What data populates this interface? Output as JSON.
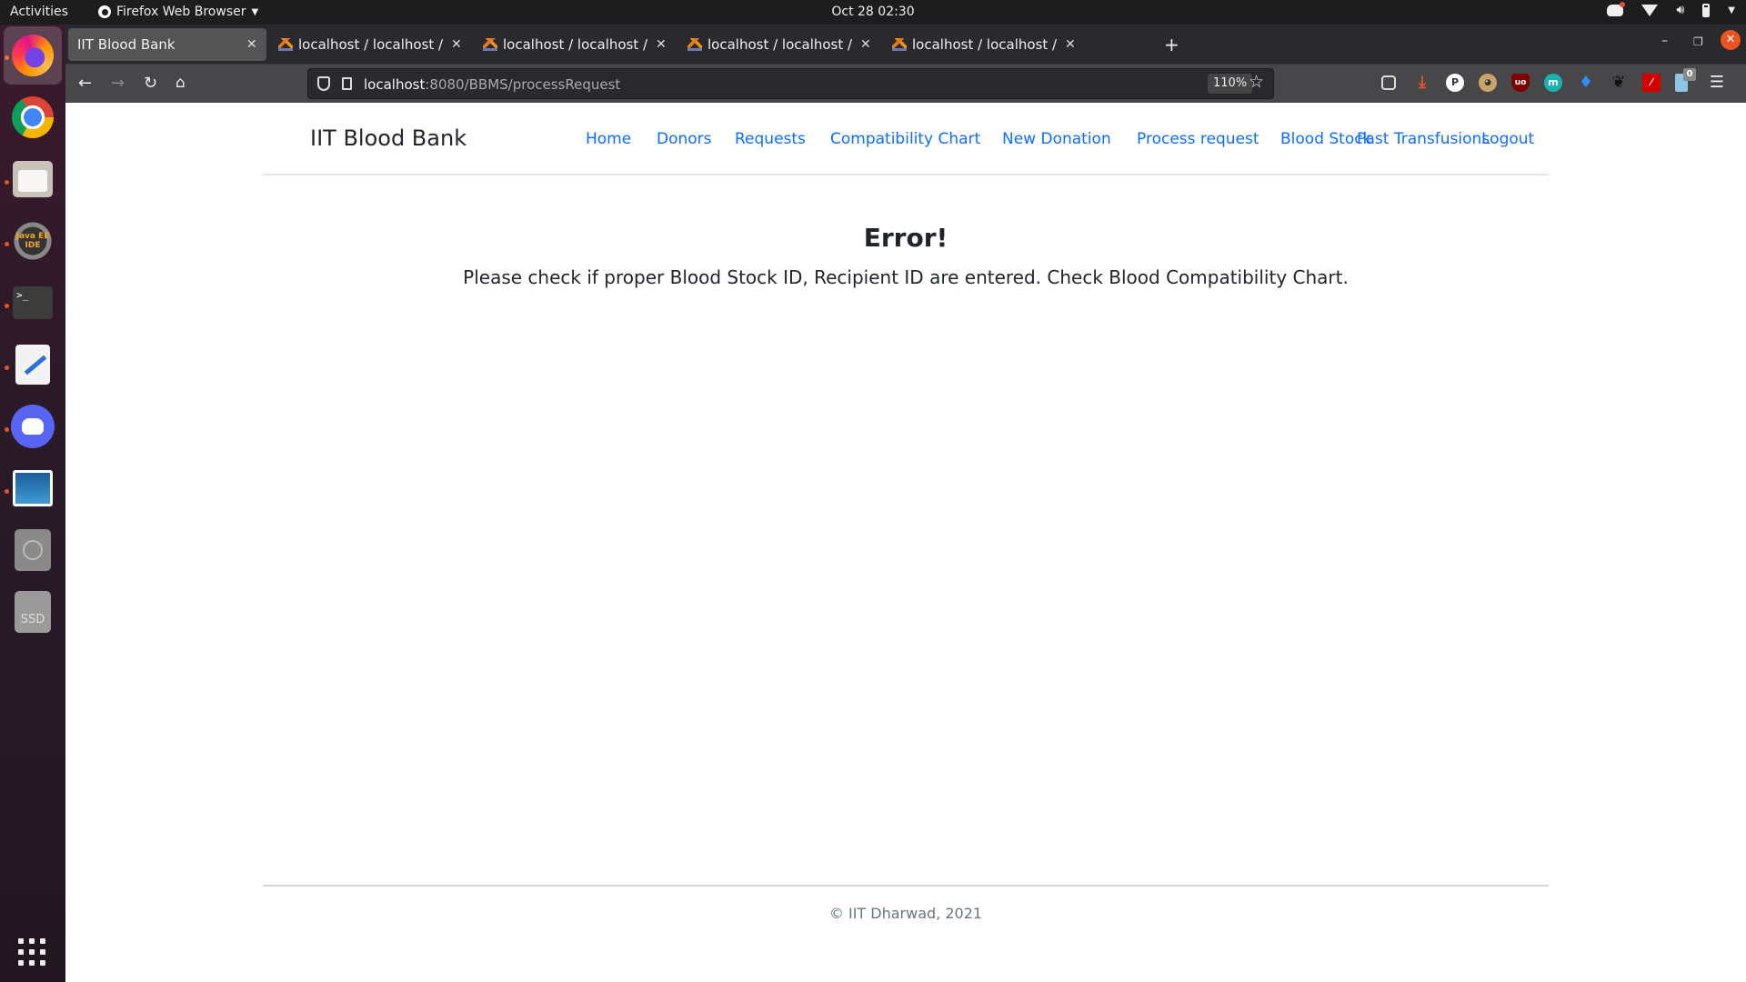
{
  "system": {
    "activities_label": "Activities",
    "app_name": "Firefox Web Browser",
    "clock": "Oct 28  02:30",
    "tray_icons": [
      "discord-icon",
      "wifi-icon",
      "volume-icon",
      "battery-icon",
      "system-menu-caret"
    ]
  },
  "dock": {
    "apps": [
      {
        "name": "firefox",
        "running": true,
        "active": true
      },
      {
        "name": "chrome",
        "running": false
      },
      {
        "name": "files",
        "running": true
      },
      {
        "name": "java-ee-ide",
        "label": "Java EE IDE",
        "running": true
      },
      {
        "name": "terminal",
        "label": ">_",
        "running": true
      },
      {
        "name": "text-editor",
        "running": true
      },
      {
        "name": "discord",
        "running": true
      },
      {
        "name": "shotwell",
        "running": true
      },
      {
        "name": "optical-disc",
        "running": false
      },
      {
        "name": "ssd-drive",
        "label": "SSD",
        "running": false
      }
    ],
    "show_apps_label": "Show Applications"
  },
  "browser": {
    "tabs": [
      {
        "title": "IIT Blood Bank",
        "active": true
      },
      {
        "title": "localhost / localhost / blo",
        "active": false
      },
      {
        "title": "localhost / localhost / blo",
        "active": false
      },
      {
        "title": "localhost / localhost / blo",
        "active": false
      },
      {
        "title": "localhost / localhost / blo",
        "active": false
      }
    ],
    "new_tab_label": "+",
    "url_host": "localhost",
    "url_rest": ":8080/BBMS/processRequest",
    "zoom_level": "110%",
    "extension_badge_count": "0",
    "window_controls": {
      "minimize": "–",
      "restore": "❐",
      "close": "✕"
    }
  },
  "site": {
    "brand": "IIT Blood Bank",
    "nav": [
      "Home",
      "Donors",
      "Requests",
      "Compatibility Chart",
      "New Donation",
      "Process request",
      "Blood Stock",
      "Past Transfusions",
      "Logout"
    ],
    "error_title": "Error!",
    "error_message": "Please check if proper Blood Stock ID, Recipient ID are entered. Check Blood Compatibility Chart.",
    "footer": "© IIT Dharwad, 2021"
  },
  "colors": {
    "link": "#0d6efd",
    "accent_orange": "#e95420"
  }
}
